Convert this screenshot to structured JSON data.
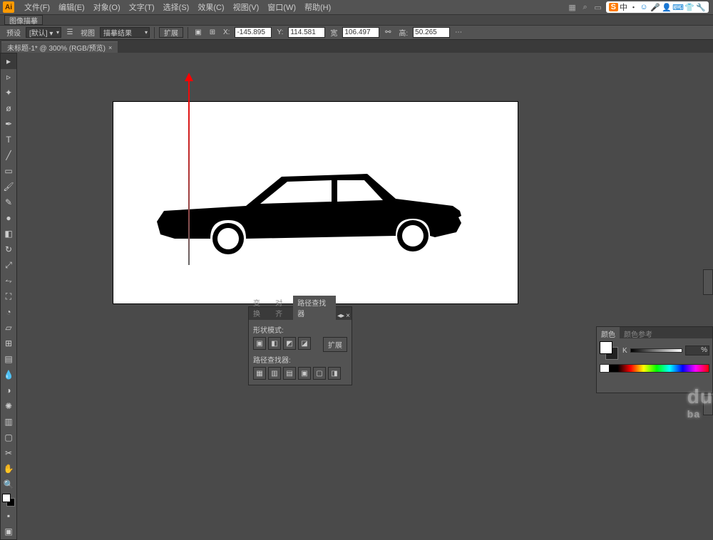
{
  "app_logo": "Ai",
  "menu": {
    "file": "文件(F)",
    "edit": "编辑(E)",
    "object": "对象(O)",
    "type": "文字(T)",
    "select": "选择(S)",
    "effect": "效果(C)",
    "view": "视图(V)",
    "window": "窗口(W)",
    "help": "帮助(H)"
  },
  "ime": {
    "s": "S",
    "txt": "中 ‧"
  },
  "controlbar": {
    "label": "图像描摹"
  },
  "options": {
    "preset_label": "预设",
    "preset_value": "[默认] ▾",
    "view_label": "视图",
    "view_value": "描摹结果",
    "expand": "扩展",
    "x": "-145.895",
    "y": "114.581",
    "w": "106.497",
    "opacity": "50.265"
  },
  "tab": {
    "title": "未标题-1* @ 300% (RGB/预览)"
  },
  "pathfinder": {
    "tab1": "变换",
    "tab2": "对齐",
    "tab3": "路径查找器",
    "shape_modes": "形状模式:",
    "expand": "扩展",
    "pathfinders": "路径查找器:"
  },
  "color": {
    "tab1": "颜色",
    "tab2": "颜色参考",
    "k_label": "K",
    "k_value": "%"
  },
  "watermark": {
    "line1": "du",
    "line2": "ba"
  }
}
